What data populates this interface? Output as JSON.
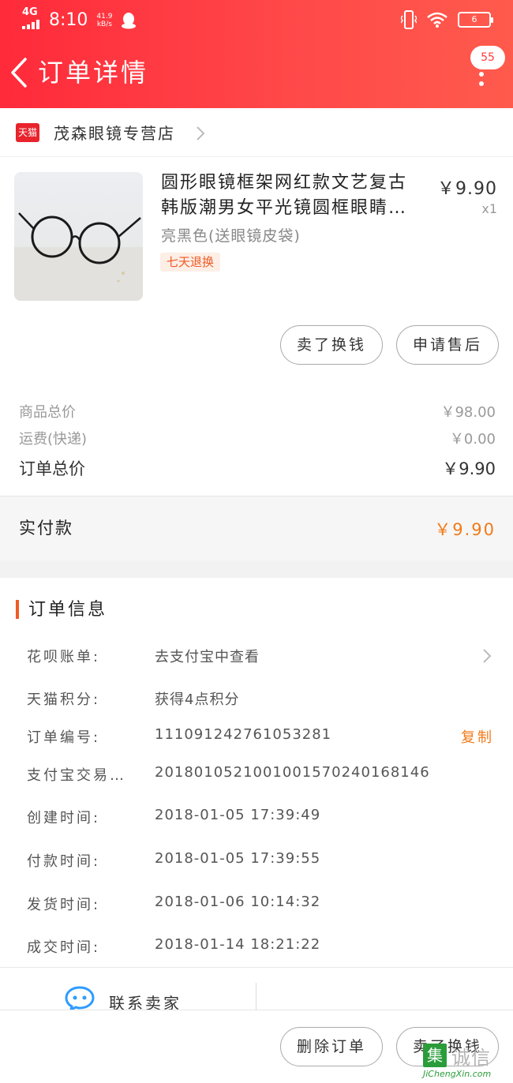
{
  "status_bar": {
    "network": "4G",
    "time": "8:10",
    "speed": "41.9 kB/s",
    "battery": "6"
  },
  "nav": {
    "title": "订单详情",
    "message_count": "55"
  },
  "store": {
    "logo_text": "天猫",
    "name": "茂森眼镜专营店"
  },
  "product": {
    "title_line1": "圆形眼镜框架网红款文艺复古",
    "title_line2": "韩版潮男女平光镜圆框眼睛…",
    "sku": "亮黑色(送眼镜皮袋)",
    "tag": "七天退换",
    "price": "￥9.90",
    "quantity": "x1",
    "buttons": {
      "exchange": "卖了换钱",
      "after_sale": "申请售后"
    }
  },
  "totals": {
    "goods_label": "商品总价",
    "goods_value": "￥98.00",
    "shipping_label": "运费(快递)",
    "shipping_value": "￥0.00",
    "order_label": "订单总价",
    "order_value": "￥9.90",
    "paid_label": "实付款",
    "paid_value": "￥9.90"
  },
  "order_info": {
    "title": "订单信息",
    "rows": [
      {
        "label": "花呗账单:",
        "value": "去支付宝中查看"
      },
      {
        "label": "天猫积分:",
        "value": "获得4点积分"
      },
      {
        "label": "订单编号:",
        "value": "111091242761053281",
        "action": "复制"
      },
      {
        "label": "支付宝交易…",
        "value": "2018010521001001570240168146"
      },
      {
        "label": "创建时间:",
        "value": "2018-01-05 17:39:49"
      },
      {
        "label": "付款时间:",
        "value": "2018-01-05 17:39:55"
      },
      {
        "label": "发货时间:",
        "value": "2018-01-06 10:14:32"
      },
      {
        "label": "成交时间:",
        "value": "2018-01-14 18:21:22"
      }
    ]
  },
  "contact": {
    "label": "联系卖家"
  },
  "bottom_actions": {
    "delete": "删除订单",
    "sell": "卖了换钱"
  },
  "watermark": {
    "box": "集",
    "name": "诚信",
    "url": "JiChengXin.com"
  },
  "colors": {
    "header_red": "#ff2a3a",
    "accent_orange": "#f27a1a",
    "tmall_red": "#e8232c",
    "contact_blue": "#2f9bff"
  }
}
